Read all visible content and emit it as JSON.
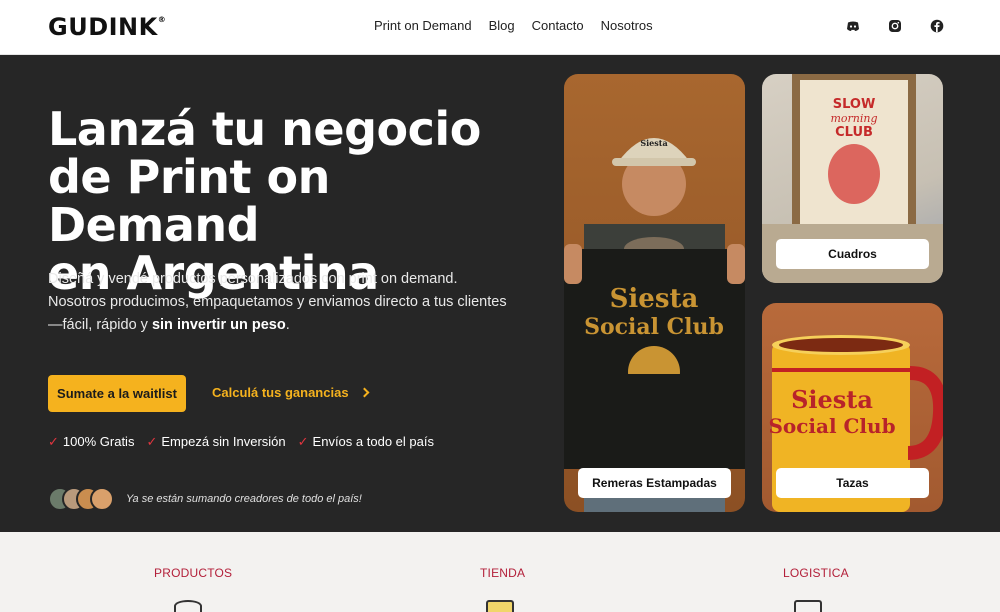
{
  "header": {
    "logo": "GUDINK",
    "logo_mark": "®",
    "nav": [
      "Print on Demand",
      "Blog",
      "Contacto",
      "Nosotros"
    ],
    "socials": [
      "discord-icon",
      "instagram-icon",
      "facebook-icon"
    ]
  },
  "hero": {
    "title_line1": "Lanzá tu negocio",
    "title_line2": "de Print on Demand",
    "title_line3": "en Argentina",
    "description": "Diseñá y vendé productos personalizados con print on demand. Nosotros producimos, empaquetamos y enviamos directo a tus clientes—fácil, rápido y ",
    "description_bold": "sin invertir un peso",
    "description_end": ".",
    "cta_primary": "Sumate a la waitlist",
    "cta_secondary": "Calculá tus ganancias",
    "benefits": [
      "100% Gratis",
      "Empezá sin Inversión",
      "Envíos a todo el país"
    ],
    "check_mark": "✓",
    "social_proof": "Ya se están sumando creadores de todo el país!"
  },
  "products": {
    "remeras": {
      "label": "Remeras Estampadas",
      "print_text": "Siesta Social Club",
      "cap_text": "Siesta"
    },
    "cuadros": {
      "label": "Cuadros",
      "poster_text": "SLOW morning CLUB"
    },
    "tazas": {
      "label": "Tazas",
      "print_text": "Siesta Social Club"
    }
  },
  "categories": [
    "PRODUCTOS",
    "TIENDA",
    "LOGISTICA"
  ],
  "colors": {
    "accent": "#f5b21e",
    "hero_bg": "#262626",
    "category_text": "#b3203a",
    "check": "#e0353f"
  }
}
